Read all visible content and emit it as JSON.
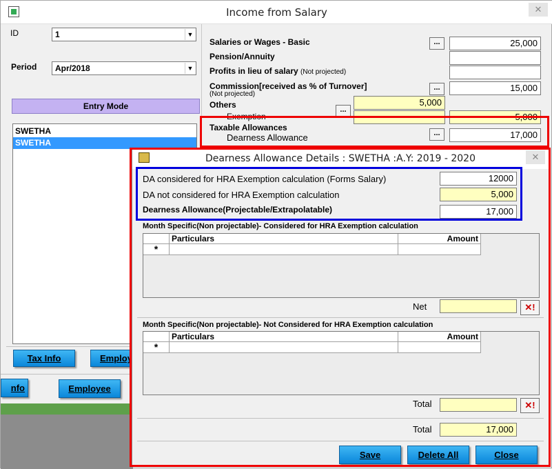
{
  "main_window": {
    "title": "Income from Salary",
    "close_glyph": "✕",
    "id_label": "ID",
    "id_value": "1",
    "period_label": "Period",
    "period_value": "Apr/2018",
    "entry_mode": "Entry Mode",
    "employees": [
      "SWETHA",
      "SWETHA"
    ],
    "buttons": {
      "tax_info": "Tax Info",
      "employ": "Employ",
      "info_frag": "nfo",
      "employee": "Employee"
    },
    "income": {
      "basic_label": "Salaries or Wages - Basic",
      "basic_value": "25,000",
      "pension_label": "Pension/Annuity",
      "profits_label": "Profits in lieu of salary",
      "not_projected": "(Not projected)",
      "commission_label": "Commission[received as % of Turnover]",
      "commission_note": "(Not projected)",
      "commission_value": "15,000",
      "others_label": "Others",
      "others_value": "5,000",
      "exemption_label": "Exemption",
      "exemption_value": "5,000",
      "taxable_label": "Taxable Allowances",
      "da_label": "Dearness Allowance",
      "da_value": "17,000",
      "dots": "..."
    }
  },
  "dialog": {
    "title": "Dearness Allowance Details : SWETHA :A.Y: 2019 - 2020",
    "close_glyph": "✕",
    "da_hra_label": "DA considered for HRA Exemption calculation (Forms Salary)",
    "da_hra_value": "12000",
    "da_not_hra_label": "DA not considered for HRA Exemption calculation",
    "da_not_hra_value": "5,000",
    "da_total_label": "Dearness Allowance(Projectable/Extrapolatable)",
    "da_total_value": "17,000",
    "section1": {
      "heading": "Month Specific(Non projectable)- Considered for HRA Exemption calculation",
      "col_particulars": "Particulars",
      "col_amount": "Amount",
      "row_marker": "*",
      "net_label": "Net"
    },
    "section2": {
      "heading": "Month Specific(Non projectable)- Not Considered for HRA Exemption calculation",
      "col_particulars": "Particulars",
      "col_amount": "Amount",
      "row_marker": "*",
      "total_label": "Total"
    },
    "grand_total_label": "Total",
    "grand_total_value": "17,000",
    "delete_glyph": "✕!",
    "buttons": {
      "save": "Save",
      "delete_all": "Delete All",
      "close": "Close"
    }
  }
}
